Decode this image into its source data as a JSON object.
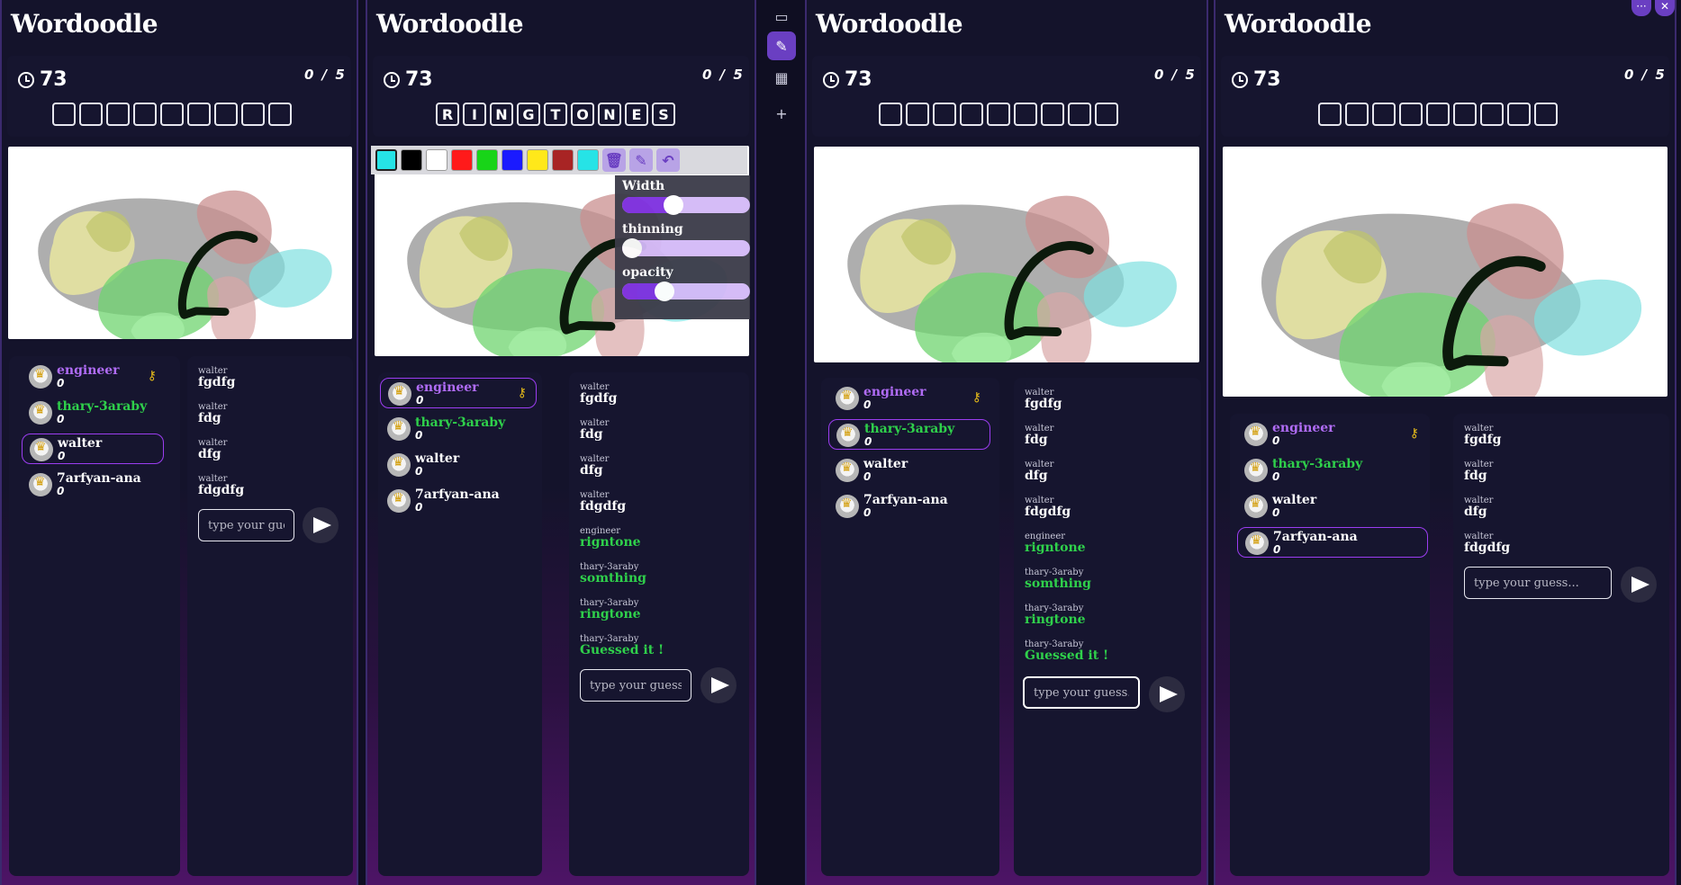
{
  "app": {
    "title": "Wordoodle"
  },
  "timer": {
    "value": "73"
  },
  "round": {
    "value": "0 / 5"
  },
  "word_revealed": [
    "R",
    "I",
    "N",
    "G",
    "T",
    "O",
    "N",
    "E",
    "S"
  ],
  "players": [
    {
      "name": "engineer",
      "score": "0",
      "color": "#b06cf5",
      "owner": true
    },
    {
      "name": "thary-3araby",
      "score": "0",
      "color": "#2fd04b"
    },
    {
      "name": "walter",
      "score": "0",
      "color": "#ffffff"
    },
    {
      "name": "7arfyan-ana",
      "score": "0",
      "color": "#ffffff"
    }
  ],
  "chat_short": [
    {
      "sender": "walter",
      "text": "fgdfg"
    },
    {
      "sender": "walter",
      "text": "fdg"
    },
    {
      "sender": "walter",
      "text": "dfg"
    },
    {
      "sender": "walter",
      "text": "fdgdfg"
    }
  ],
  "chat_full": [
    {
      "sender": "walter",
      "text": "fgdfg",
      "color": "#ffffff"
    },
    {
      "sender": "walter",
      "text": "fdg",
      "color": "#ffffff"
    },
    {
      "sender": "walter",
      "text": "dfg",
      "color": "#ffffff"
    },
    {
      "sender": "walter",
      "text": "fdgdfg",
      "color": "#ffffff"
    },
    {
      "sender": "engineer",
      "text": "rigntone",
      "color": "#2fd04b"
    },
    {
      "sender": "thary-3araby",
      "text": "somthing",
      "color": "#2fd04b"
    },
    {
      "sender": "thary-3araby",
      "text": "ringtone",
      "color": "#2fd04b"
    },
    {
      "sender": "thary-3araby",
      "text": "Guessed it !",
      "color": "#2fd04b"
    }
  ],
  "input": {
    "placeholder": "type your guess..."
  },
  "palette": [
    "#26e3e6",
    "#000000",
    "#ffffff",
    "#ff1a1a",
    "#18d418",
    "#1a1aff",
    "#ffe81a",
    "#a82424",
    "#26e3e6"
  ],
  "brush_options": {
    "width_label": "Width",
    "width_value": 0.4,
    "thinning_label": "thinning",
    "thinning_value": 0.08,
    "opacity_label": "opacity",
    "opacity_value": 0.33
  },
  "rail": {
    "icons": [
      "sidebar-toggle-icon",
      "pen-icon",
      "palette-icon",
      "plus-icon"
    ]
  }
}
